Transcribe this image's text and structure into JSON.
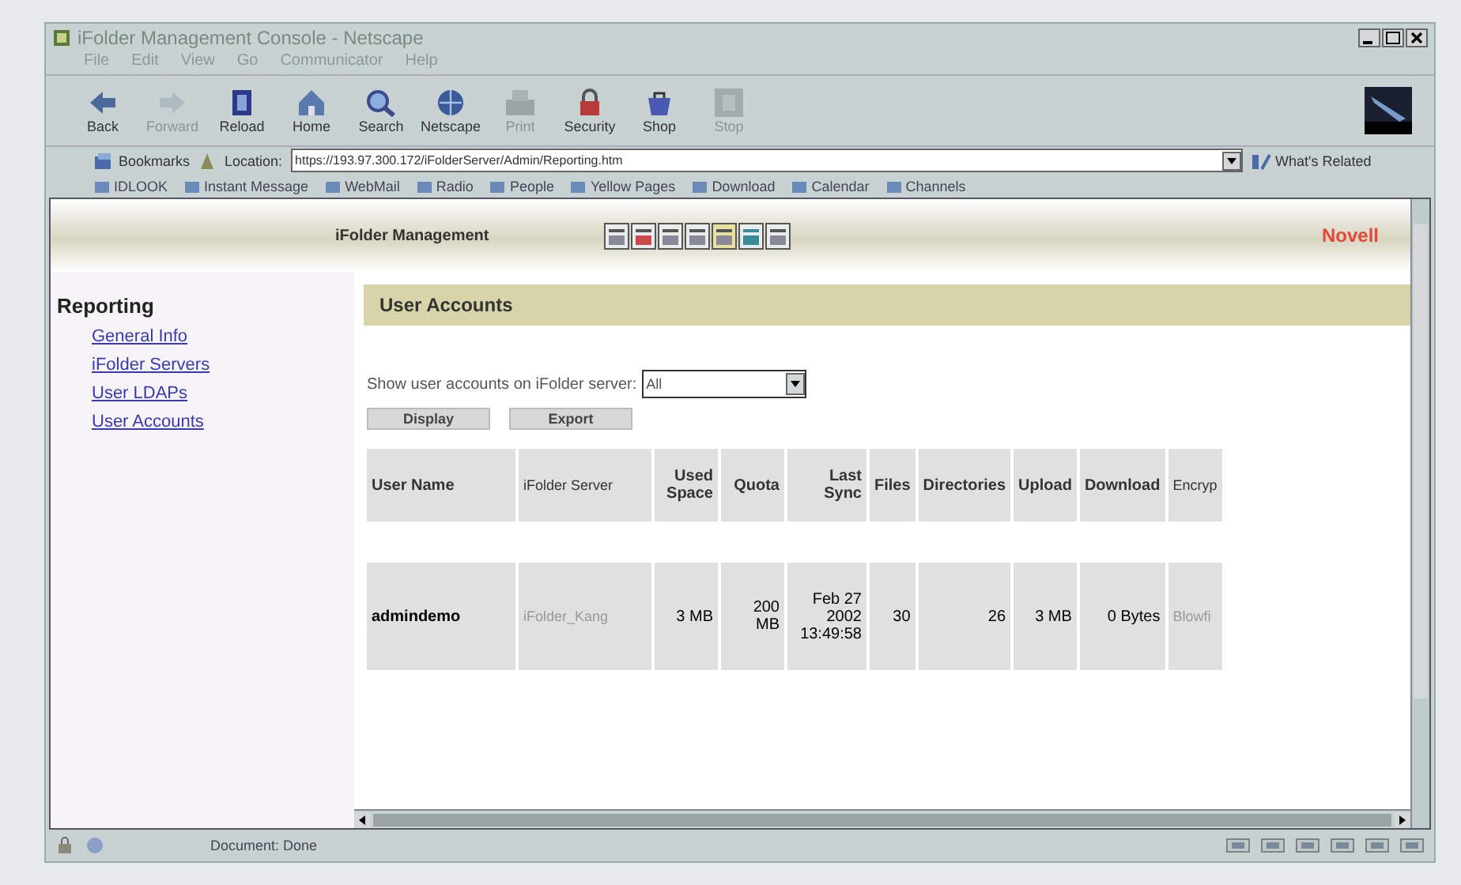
{
  "window": {
    "title": "iFolder Management Console - Netscape"
  },
  "menu": [
    "File",
    "Edit",
    "View",
    "Go",
    "Communicator",
    "Help"
  ],
  "toolbar": [
    {
      "label": "Back",
      "disabled": false
    },
    {
      "label": "Forward",
      "disabled": true
    },
    {
      "label": "Reload",
      "disabled": false
    },
    {
      "label": "Home",
      "disabled": false
    },
    {
      "label": "Search",
      "disabled": false
    },
    {
      "label": "Netscape",
      "disabled": false
    },
    {
      "label": "Print",
      "disabled": true
    },
    {
      "label": "Security",
      "disabled": false
    },
    {
      "label": "Shop",
      "disabled": false
    },
    {
      "label": "Stop",
      "disabled": true
    }
  ],
  "location": {
    "bookmarks": "Bookmarks",
    "label": "Location:",
    "url": "https://193.97.300.172/iFolderServer/Admin/Reporting.htm",
    "related": "What's Related"
  },
  "personal_toolbar": [
    "IDLOOK",
    "Instant Message",
    "WebMail",
    "Radio",
    "People",
    "Yellow Pages",
    "Download",
    "Calendar",
    "Channels"
  ],
  "page": {
    "title": "iFolder Management",
    "brand": "Novell"
  },
  "sidebar": {
    "heading": "Reporting",
    "items": [
      "General Info",
      "iFolder Servers",
      "User LDAPs",
      "User Accounts"
    ]
  },
  "main": {
    "heading": "User Accounts",
    "filter_label": "Show user accounts on iFolder server:",
    "filter_value": "All",
    "buttons": [
      "Display",
      "Export"
    ],
    "table": {
      "columns": [
        "User Name",
        "iFolder Server",
        "Used Space",
        "Quota",
        "Last Sync",
        "Files",
        "Directories",
        "Upload",
        "Download",
        "Encryp"
      ],
      "rows": [
        [
          "admindemo",
          "iFolder_Kang",
          "3 MB",
          "200 MB",
          "Feb 27 2002 13:49:58",
          "30",
          "26",
          "3 MB",
          "0 Bytes",
          "Blowfi"
        ]
      ]
    }
  },
  "status_bar": {
    "text": "Document: Done"
  }
}
